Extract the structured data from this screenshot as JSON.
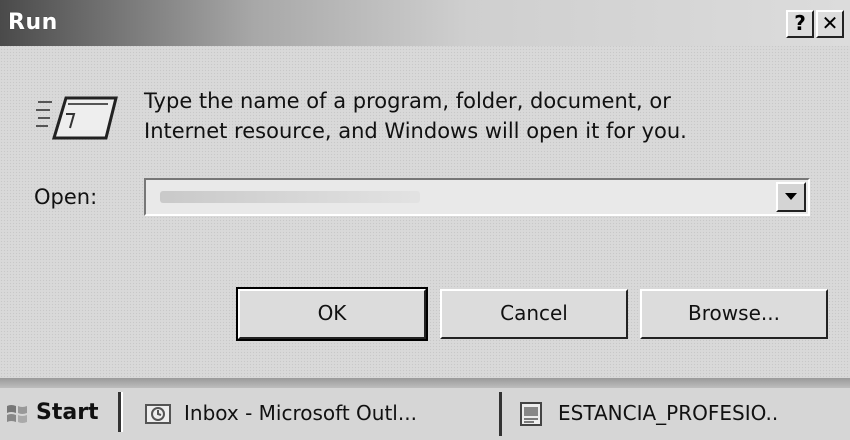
{
  "dialog": {
    "title": "Run",
    "help_button": "?",
    "close_button": "✕",
    "icon": "run-icon",
    "description_line1": "Type the name of a program, folder, document, or",
    "description_line2": "Internet resource, and Windows will open it for you.",
    "open_label": "Open:",
    "open_value": "",
    "buttons": {
      "ok": "OK",
      "cancel": "Cancel",
      "browse": "Browse..."
    }
  },
  "taskbar": {
    "start_label": "Start",
    "tasks": [
      {
        "label": "Inbox - Microsoft Outl...",
        "icon": "outlook-icon"
      },
      {
        "label": "ESTANCIA_PROFESIO..",
        "icon": "word-document-icon"
      }
    ]
  }
}
